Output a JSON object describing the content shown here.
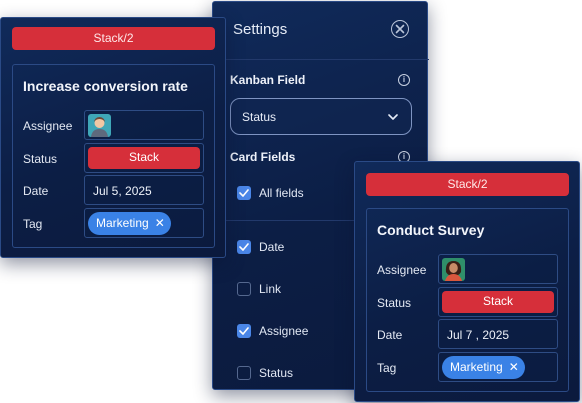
{
  "settings": {
    "title": "Settings",
    "kanban_field_label": "Kanban Field",
    "kanban_field_value": "Status",
    "card_fields_label": "Card Fields",
    "checkboxes": [
      {
        "label": "All fields",
        "checked": true
      },
      {
        "label": "Date",
        "checked": true
      },
      {
        "label": "Link",
        "checked": false
      },
      {
        "label": "Assignee",
        "checked": true
      },
      {
        "label": "Status",
        "checked": false
      }
    ]
  },
  "card1": {
    "header": "Stack/2",
    "title": "Increase conversion rate",
    "assignee_label": "Assignee",
    "status_label": "Status",
    "status_value": "Stack",
    "date_label": "Date",
    "date_value": "Jul 5, 2025",
    "tag_label": "Tag",
    "tag_value": "Marketing",
    "tag_remove": "✕"
  },
  "card2": {
    "header": "Stack/2",
    "title": "Conduct Survey",
    "assignee_label": "Assignee",
    "status_label": "Status",
    "status_value": "Stack",
    "date_label": "Date",
    "date_value": "Jul 7 , 2025",
    "tag_label": "Tag",
    "tag_value": "Marketing",
    "tag_remove": "✕"
  },
  "colors": {
    "panel_bg": "#0c1e45",
    "accent_red": "#d62f3a",
    "accent_blue": "#3a82e6",
    "checkbox_blue": "#4a86e8"
  }
}
